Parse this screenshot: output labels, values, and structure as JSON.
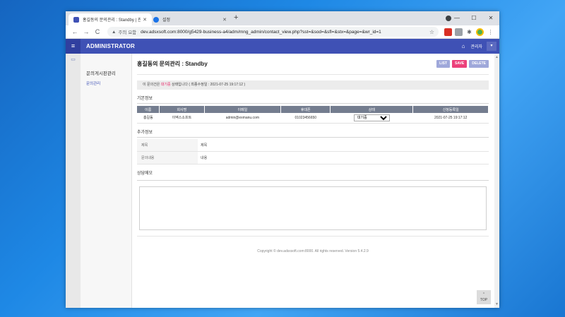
{
  "browser": {
    "tabs": [
      {
        "title": "홍길동의 문의관리 : Standby | 관리자"
      },
      {
        "title": "설정"
      }
    ],
    "new_tab": "+",
    "address": {
      "security_label": "주의 요함",
      "url": "dev.adsxsoft.com:8000/g5429-business-a4/adm/mng_admin/contact_view.php?sst=&sod=&sfl=&stx=&page=&wr_id=1"
    },
    "nav": {
      "back": "←",
      "forward": "→",
      "reload": "C"
    },
    "window_controls": {
      "minimize": "—",
      "maximize": "☐",
      "close": "✕"
    }
  },
  "admin": {
    "brand": "ADMINISTRATOR",
    "user": "관리자",
    "menu_icon": "≡",
    "home_icon": "⌂",
    "dropdown_icon": "▾"
  },
  "sidebar": {
    "title": "문의게시판관리",
    "items": [
      {
        "label": "문의관리"
      }
    ]
  },
  "page": {
    "title": "홍길동의 문의관리 : Standby",
    "buttons": {
      "list": "LIST",
      "save": "SAVE",
      "delete": "DELETE"
    },
    "notice": {
      "prefix": "이 문의건은",
      "status": "대기중",
      "middle": "상태입니다 ( 최종수정일 :",
      "date": "2021-07-25 19:17:12",
      "suffix": ")"
    },
    "basic": {
      "heading": "기본정보",
      "columns": [
        "이름",
        "회사명",
        "이메일",
        "휴대폰",
        "상태",
        "신청등록일"
      ],
      "row": {
        "name": "홍길동",
        "company": "이엑스소프트",
        "email": "admin@exmanu.com",
        "phone": "01023456650",
        "status": "대기중",
        "registered": "2021-07-25 19:17:12"
      }
    },
    "additional": {
      "heading": "추가정보",
      "rows": [
        {
          "label": "제목",
          "value": "제목"
        },
        {
          "label": "문의내용",
          "value": "내용"
        }
      ]
    },
    "memo": {
      "heading": "상담메모",
      "value": ""
    },
    "footer": "Copyright © dev.adsxsoft.com:8000. All rights reserved. Version 5.4.2.9",
    "top_button": "TOP"
  }
}
